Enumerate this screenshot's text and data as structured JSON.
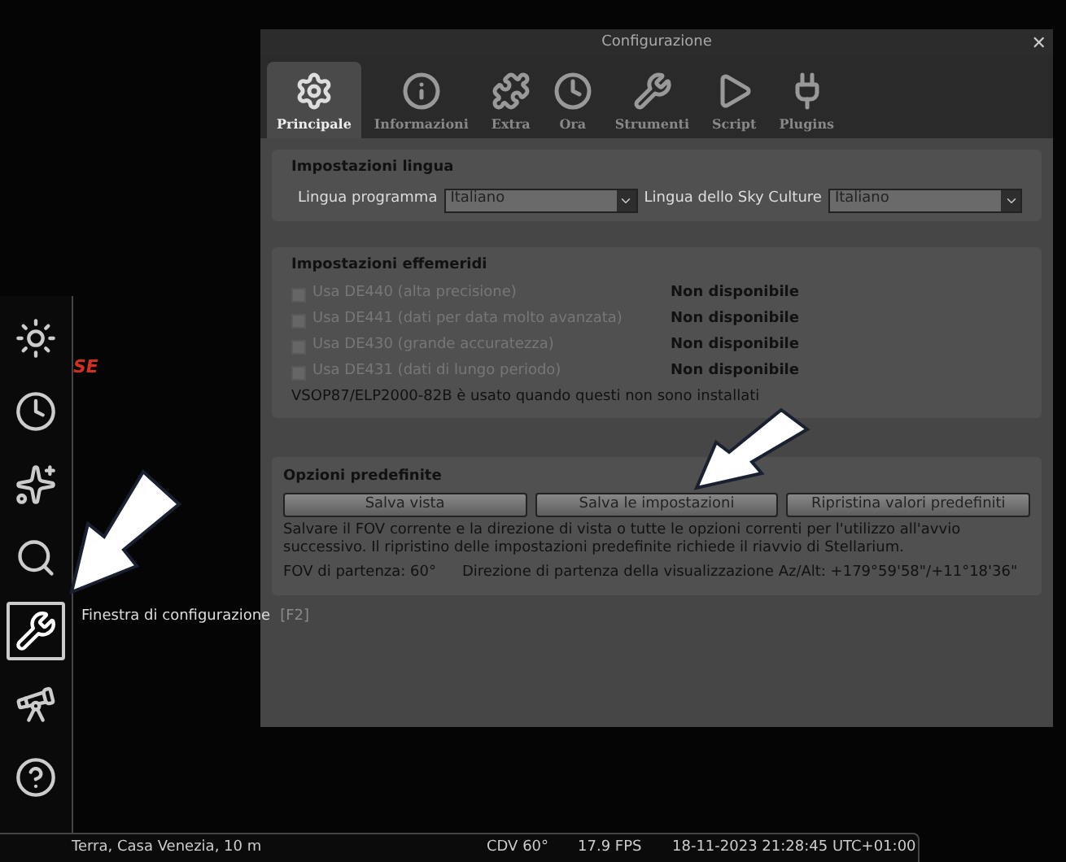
{
  "sky": {
    "compass_label": "SE"
  },
  "window": {
    "title": "Configurazione",
    "close": "✕"
  },
  "tabs": [
    {
      "label": "Principale",
      "kind": "gear",
      "selected": true
    },
    {
      "label": "Informazioni",
      "kind": "info",
      "selected": false
    },
    {
      "label": "Extra",
      "kind": "extra",
      "selected": false
    },
    {
      "label": "Ora",
      "kind": "clock",
      "selected": false
    },
    {
      "label": "Strumenti",
      "kind": "tools",
      "selected": false
    },
    {
      "label": "Script",
      "kind": "play",
      "selected": false
    },
    {
      "label": "Plugins",
      "kind": "plug",
      "selected": false
    }
  ],
  "language": {
    "title": "Impostazioni lingua",
    "fields": [
      {
        "label": "Lingua programma",
        "value": "Italiano"
      },
      {
        "label": "Lingua dello Sky Culture",
        "value": "Italiano"
      }
    ]
  },
  "ephemeris": {
    "title": "Impostazioni effemeridi",
    "items": [
      {
        "label": "Usa DE440 (alta precisione)",
        "status": "Non disponibile",
        "checked": false,
        "disabled": true
      },
      {
        "label": "Usa DE441 (dati per data molto avanzata)",
        "status": "Non disponibile",
        "checked": false,
        "disabled": true
      },
      {
        "label": "Usa DE430 (grande accuratezza)",
        "status": "Non disponibile",
        "checked": false,
        "disabled": true
      },
      {
        "label": "Usa DE431 (dati di lungo periodo)",
        "status": "Non disponibile",
        "checked": false,
        "disabled": true
      }
    ],
    "note": "VSOP87/ELP2000-82B è usato quando questi non sono installati"
  },
  "defaults": {
    "title": "Opzioni predefinite",
    "buttons": [
      "Salva vista",
      "Salva le impostazioni",
      "Ripristina valori predefiniti"
    ],
    "description": "Salvare il FOV corrente e la direzione di vista o tutte le opzioni correnti per l'utilizzo all'avvio successivo. Il ripristino delle impostazioni predefinite richiede il riavvio di Stellarium.",
    "fov": "FOV di partenza: 60°",
    "direction": "Direzione di partenza della visualizzazione Az/Alt: +179°59'58\"/+11°18'36\""
  },
  "sidebar": {
    "items": [
      {
        "kind": "sun",
        "selected": false
      },
      {
        "kind": "clock",
        "selected": false
      },
      {
        "kind": "deepsky",
        "selected": false
      },
      {
        "kind": "search",
        "selected": false
      },
      {
        "kind": "settings",
        "selected": true
      },
      {
        "kind": "telescope",
        "selected": false
      },
      {
        "kind": "help",
        "selected": false
      }
    ],
    "tooltip": {
      "text": "Finestra di configurazione",
      "shortcut": "[F2]"
    }
  },
  "status_bar": {
    "location": "Terra, Casa Venezia, 10 m",
    "fov": "CDV 60°",
    "fps": "17.9 FPS",
    "datetime": "18-11-2023 21:28:45 UTC+01:00"
  }
}
